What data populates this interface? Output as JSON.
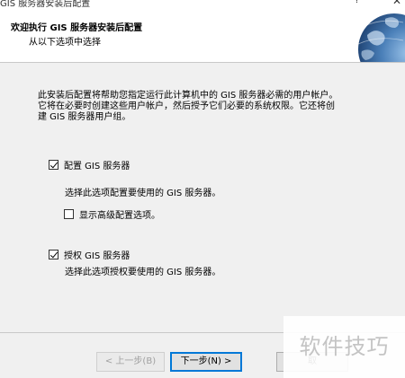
{
  "window": {
    "title": "GIS 服务器安装后配置",
    "help_label": "?",
    "close_label": "✕"
  },
  "header": {
    "title": "欢迎执行 GIS 服务器安装后配置",
    "subtitle": "从以下选项中选择",
    "logo_icon": "globe-icon"
  },
  "main": {
    "intro_line1": "此安装后配置将帮助您指定运行此计算机中的 GIS 服务器必需的用户帐户。",
    "intro_line2": "它将在必要时创建这些用户帐户，然后授予它们必要的系统权限。它还将创",
    "intro_line3": "建 GIS 服务器用户组。",
    "options": [
      {
        "label": "配置 GIS 服务器",
        "checked": true,
        "description": "选择此选项配置要使用的 GIS 服务器。"
      },
      {
        "label": "显示高级配置选项。",
        "checked": false
      },
      {
        "label": "授权 GIS 服务器",
        "checked": true,
        "description": "选择此选项授权要使用的 GIS 服务器。"
      }
    ]
  },
  "buttons": {
    "back": "< 上一步(B)",
    "next": "下一步(N) >",
    "cancel": "取"
  },
  "watermark": {
    "text": "软件技巧"
  }
}
